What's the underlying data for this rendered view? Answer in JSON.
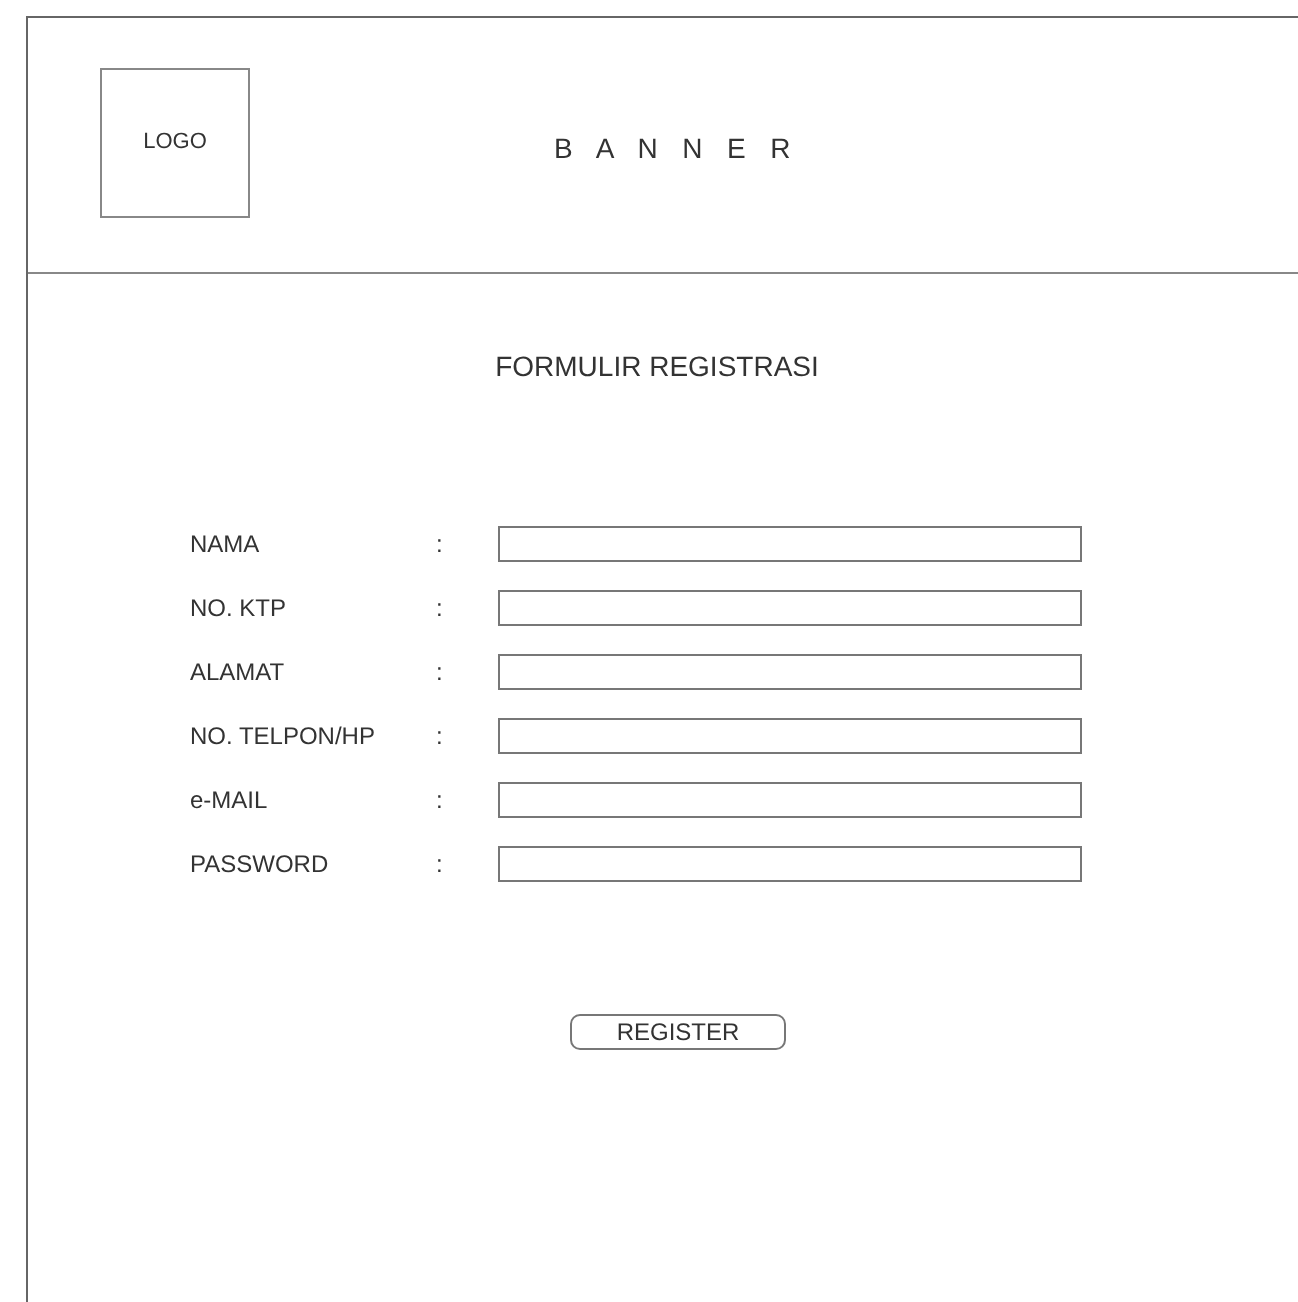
{
  "header": {
    "logo": "LOGO",
    "banner": "B A N N E R"
  },
  "form": {
    "title": "FORMULIR REGISTRASI",
    "fields": [
      {
        "label": "NAMA",
        "separator": ":"
      },
      {
        "label": "NO. KTP",
        "separator": ":"
      },
      {
        "label": "ALAMAT",
        "separator": ":"
      },
      {
        "label": "NO. TELPON/HP",
        "separator": ":"
      },
      {
        "label": "e-MAIL",
        "separator": ":"
      },
      {
        "label": "PASSWORD",
        "separator": ":"
      }
    ],
    "submit": "REGISTER"
  }
}
